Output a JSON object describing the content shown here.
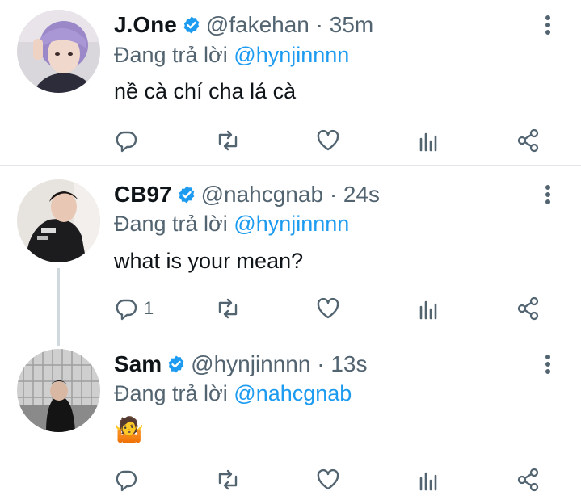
{
  "tweets": [
    {
      "name": "J.One",
      "handle": "@fakehan",
      "time": "· 35m",
      "reply_prefix": "Đang trả lời",
      "reply_to": "@hynjinnnn",
      "body": "nề cà chí cha lá cà",
      "reply_count": ""
    },
    {
      "name": "CB97",
      "handle": "@nahcgnab",
      "time": "· 24s",
      "reply_prefix": "Đang trả lời",
      "reply_to": "@hynjinnnn",
      "body": "what is your mean?",
      "reply_count": "1"
    },
    {
      "name": "Sam",
      "handle": "@hynjinnnn",
      "time": "· 13s",
      "reply_prefix": "Đang trả lời",
      "reply_to": "@nahcgnab",
      "body": "🤷",
      "reply_count": ""
    }
  ],
  "icons": {
    "reply": "reply-icon",
    "retweet": "retweet-icon",
    "like": "heart-icon",
    "analytics": "analytics-icon",
    "share": "share-icon",
    "more": "more-vertical-icon",
    "verified": "verified-badge-icon"
  },
  "colors": {
    "accent": "#1d9bf0",
    "text": "#0f1419",
    "secondary": "#536471"
  }
}
